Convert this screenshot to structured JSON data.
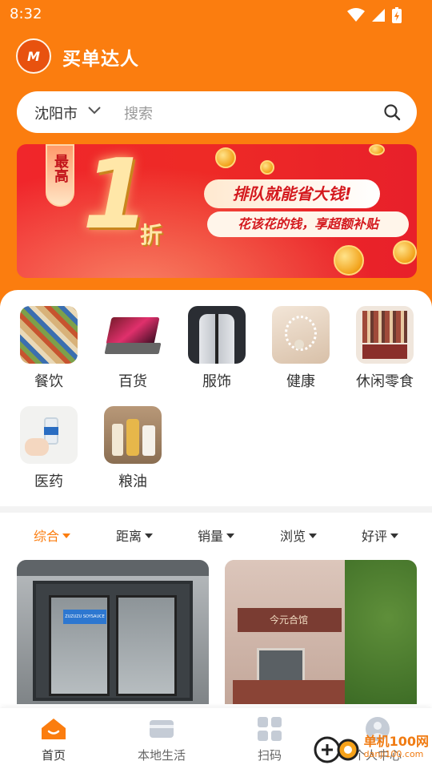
{
  "status_bar": {
    "time": "8:32"
  },
  "app": {
    "title": "买单达人",
    "logo_text": "M"
  },
  "search": {
    "city": "沈阳市",
    "placeholder": "搜索"
  },
  "banner": {
    "badge": "最高",
    "big_number": "1",
    "unit": "折",
    "slogan": "排队就能省大钱!",
    "subslogan": "花该花的钱，享超额补贴"
  },
  "categories": [
    {
      "label": "餐饮",
      "icon": "snacks-photo"
    },
    {
      "label": "百货",
      "icon": "laptop-photo"
    },
    {
      "label": "服饰",
      "icon": "jacket-photo"
    },
    {
      "label": "健康",
      "icon": "jewelry-photo"
    },
    {
      "label": "休闲零食",
      "icon": "shelf-photo"
    },
    {
      "label": "医药",
      "icon": "medicine-photo"
    },
    {
      "label": "粮油",
      "icon": "oil-photo"
    }
  ],
  "sort_tabs": [
    {
      "label": "综合",
      "active": true
    },
    {
      "label": "距离",
      "active": false
    },
    {
      "label": "销量",
      "active": false
    },
    {
      "label": "浏览",
      "active": false
    },
    {
      "label": "好评",
      "active": false
    }
  ],
  "shops": [
    {
      "icon": "storefront-glass-door-photo",
      "sign": "ZUZUZU SOYSAUCE"
    },
    {
      "icon": "storefront-pink-building-photo",
      "sign": "今元合馆"
    }
  ],
  "tabbar": [
    {
      "label": "首页",
      "icon": "home-icon",
      "active": true
    },
    {
      "label": "本地生活",
      "icon": "card-icon",
      "active": false
    },
    {
      "label": "扫码",
      "icon": "grid-icon",
      "active": false
    },
    {
      "label": "个人中心",
      "icon": "user-icon",
      "active": false
    }
  ],
  "watermark": {
    "text": "单机100网",
    "url": "danji100.com"
  },
  "colors": {
    "brand": "#fb7d0f",
    "banner_red": "#ee2a26",
    "text": "#333333"
  }
}
